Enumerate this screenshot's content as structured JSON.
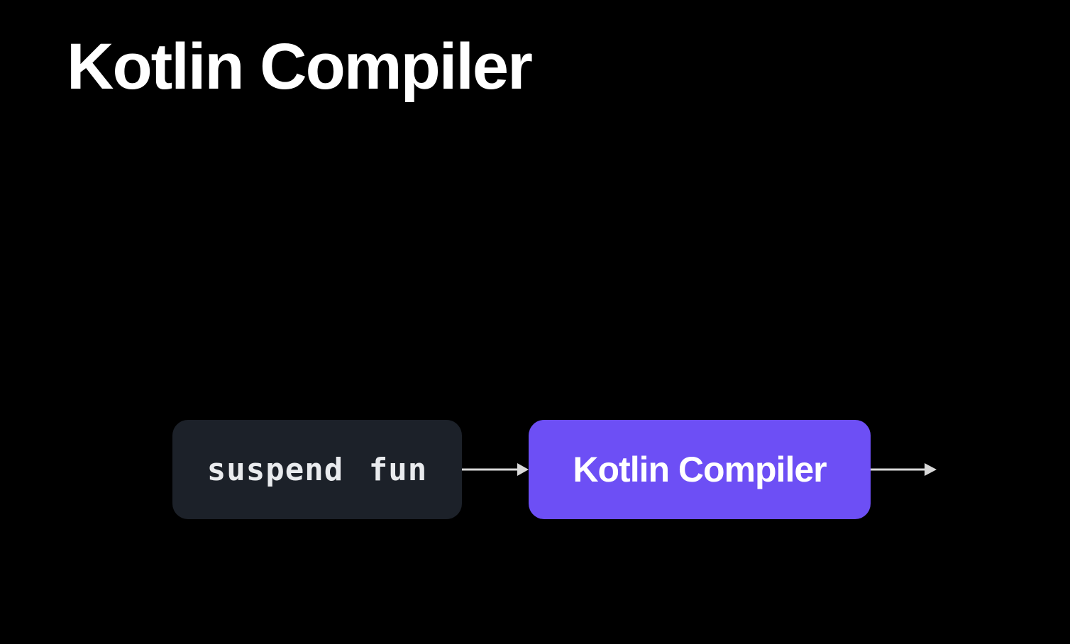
{
  "slide": {
    "title": "Kotlin Compiler"
  },
  "diagram": {
    "nodes": [
      {
        "id": "source",
        "label": "suspend fun",
        "fill": "#1c2129",
        "text_color": "#e9ebee"
      },
      {
        "id": "compiler",
        "label": "Kotlin Compiler",
        "fill": "#6d4ff5",
        "text_color": "#ffffff"
      }
    ],
    "edges": [
      {
        "from": "source",
        "to": "compiler"
      },
      {
        "from": "compiler",
        "to": ""
      }
    ],
    "arrow_color": "#d9d9d9",
    "background": "#000000"
  }
}
